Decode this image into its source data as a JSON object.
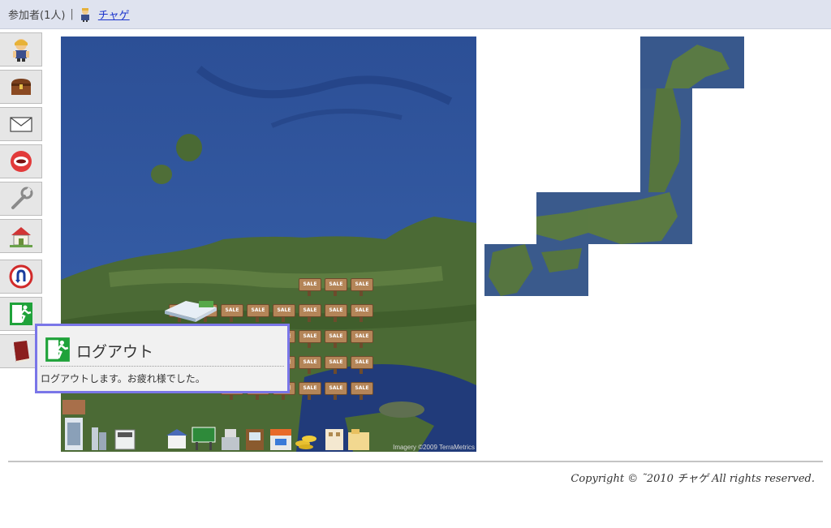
{
  "header": {
    "participants_label": "参加者(1人)",
    "separator": "|",
    "user_name": "チャゲ"
  },
  "sidebar": {
    "items": [
      {
        "name": "avatar-button",
        "icon": "avatar-icon"
      },
      {
        "name": "treasure-chest-button",
        "icon": "treasure-chest-icon"
      },
      {
        "name": "mail-button",
        "icon": "envelope-icon"
      },
      {
        "name": "chat-button",
        "icon": "mouth-icon"
      },
      {
        "name": "settings-button",
        "icon": "wrench-icon"
      },
      {
        "name": "home-button",
        "icon": "house-icon"
      },
      {
        "name": "u-turn-button",
        "icon": "u-turn-sign-icon"
      },
      {
        "name": "logout-button",
        "icon": "exit-sign-icon"
      },
      {
        "name": "book-button",
        "icon": "book-icon"
      }
    ]
  },
  "map": {
    "sale_label": "SALE",
    "credit": "Imagery ©2009 TerraMetrics"
  },
  "tooltip": {
    "title": "ログアウト",
    "description": "ログアウトします。お疲れ様でした。"
  },
  "footer": {
    "copyright": "Copyright © ˜2010 チャゲ All rights reserved."
  }
}
